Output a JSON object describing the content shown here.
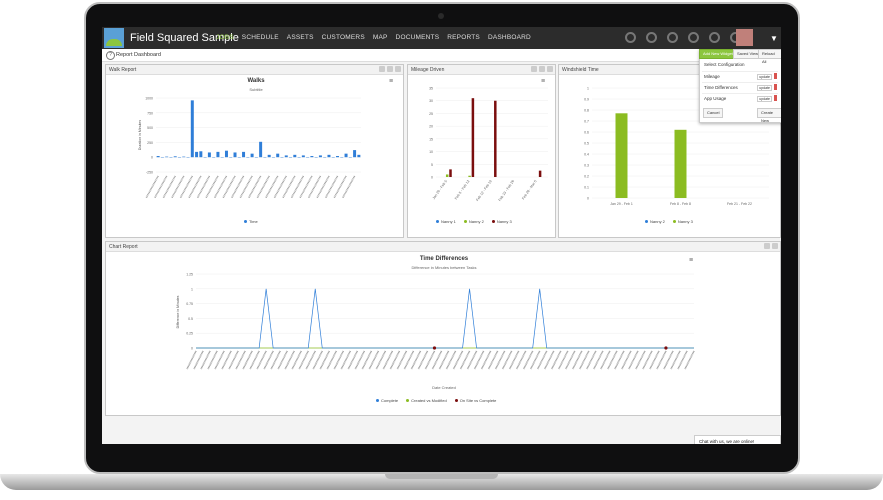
{
  "app": {
    "brand": "Field Squared Sample"
  },
  "nav": [
    "JOBS",
    "SCHEDULE",
    "ASSETS",
    "CUSTOMERS",
    "MAP",
    "DOCUMENTS",
    "REPORTS",
    "DASHBOARD"
  ],
  "subbar": {
    "title": "Report Dashboard"
  },
  "dropdown": {
    "add_widget": "Add New Widget",
    "saved_views": "Saved Views",
    "reload": "Reload All",
    "heading": "Select Configuration",
    "items": [
      {
        "label": "Mileage",
        "action": "update"
      },
      {
        "label": "Time Differences",
        "action": "update"
      },
      {
        "label": "App Usage",
        "action": "update"
      }
    ],
    "cancel": "Cancel",
    "create": "Create New",
    "colors": {
      "accent": "#8cc63f",
      "delete": "#d9534f"
    }
  },
  "panels": {
    "walk": {
      "title": "Walk Report"
    },
    "mileage": {
      "title": "Mileage Driven"
    },
    "windshield": {
      "title": "Windshield Time"
    },
    "chartreport": {
      "title": "Chart Report"
    }
  },
  "chat": {
    "label": "Chat with us, we are online!"
  },
  "chart_data": [
    {
      "type": "bar",
      "title": "Walks",
      "subtitle": "Subtitle",
      "ylabel": "Duration in Minutes",
      "ylim": [
        -250,
        1000
      ],
      "yticks": [
        1000,
        750,
        500,
        250,
        0,
        -250
      ],
      "series": [
        {
          "name": "Time",
          "color": "#2f7ed8",
          "values": [
            20,
            0,
            10,
            0,
            15,
            0,
            10,
            0,
            960,
            90,
            100,
            0,
            80,
            0,
            90,
            0,
            110,
            0,
            80,
            0,
            90,
            0,
            60,
            0,
            260,
            0,
            40,
            0,
            60,
            0,
            30,
            0,
            40,
            0,
            30,
            0,
            20,
            0,
            30,
            0,
            40,
            0,
            20,
            0,
            60,
            0,
            120,
            40
          ]
        }
      ]
    },
    {
      "type": "bar",
      "categories": [
        "Jan 29 - Feb 5",
        "Feb 5 - Feb 12",
        "Feb 12 - Feb 19",
        "Feb 19 - Feb 26",
        "Feb 26 - Mar 5"
      ],
      "ylim": [
        0,
        35
      ],
      "yticks": [
        35,
        30,
        25,
        20,
        15,
        10,
        5,
        0
      ],
      "series": [
        {
          "name": "Nanny 1",
          "color": "#2f7ed8",
          "values": [
            0,
            0,
            0,
            0,
            0
          ]
        },
        {
          "name": "Nanny 2",
          "color": "#8bbc21",
          "values": [
            1,
            0.5,
            0,
            0,
            0
          ]
        },
        {
          "name": "Nanny 3",
          "color": "#7b0e0e",
          "values": [
            3,
            31,
            30,
            0,
            2.5
          ]
        }
      ]
    },
    {
      "type": "bar",
      "categories": [
        "Jan 29 - Feb 1",
        "Feb 8 - Feb 8",
        "Feb 21 - Feb 22"
      ],
      "yticks": [
        1,
        0.9,
        0.8,
        0.7,
        0.6,
        0.5,
        0.4,
        0.3,
        0.2,
        0.1,
        0
      ],
      "ylim": [
        0,
        1
      ],
      "series": [
        {
          "name": "Nanny 2",
          "color": "#2f7ed8",
          "values": [
            0,
            0,
            0
          ]
        },
        {
          "name": "Nanny 3",
          "color": "#8bbc21",
          "values": [
            0.77,
            0.62,
            0
          ]
        }
      ]
    },
    {
      "type": "line",
      "title": "Time Differences",
      "subtitle": "Difference in Minutes between Tasks",
      "xlabel": "Date Created",
      "ylabel": "Difference in Minutes",
      "ylim": [
        0,
        1.25
      ],
      "yticks": [
        1.25,
        1,
        0.75,
        0.5,
        0.25,
        0
      ],
      "points": 72,
      "series": [
        {
          "name": "Complete",
          "color": "#2f7ed8",
          "spikes": [
            {
              "i": 10,
              "v": 1
            },
            {
              "i": 17,
              "v": 1
            },
            {
              "i": 39,
              "v": 1
            },
            {
              "i": 49,
              "v": 1
            }
          ]
        },
        {
          "name": "Created vs Modified",
          "color": "#8bbc21",
          "spikes": []
        },
        {
          "name": "On Site vs Complete",
          "color": "#7b0e0e",
          "dots": [
            34,
            67
          ]
        }
      ]
    }
  ]
}
